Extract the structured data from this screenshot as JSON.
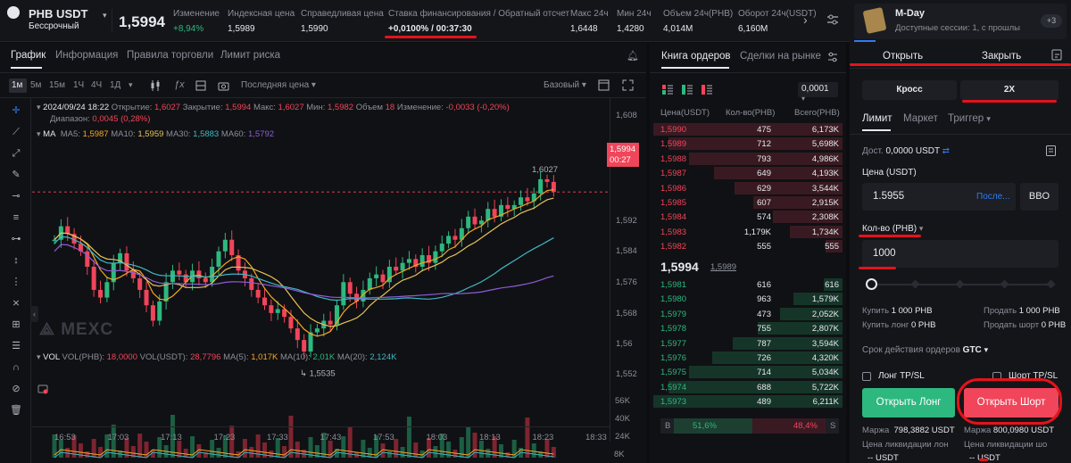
{
  "header": {
    "symbol": "PHB USDT",
    "contract_type": "Бессрочный",
    "last_price": "1,5994",
    "stats": [
      {
        "label": "Изменение",
        "value": "+8,94%"
      },
      {
        "label": "Индексная цена",
        "value": "1,5989"
      },
      {
        "label": "Справедливая цена",
        "value": "1,5990"
      },
      {
        "label": "Ставка финансирования / Обратный отсчет",
        "value": "+0,0100% / 00:37:30"
      },
      {
        "label": "Макс 24ч",
        "value": "1,6448"
      },
      {
        "label": "Мин 24ч",
        "value": "1,4280"
      },
      {
        "label": "Объем 24ч(PHB)",
        "value": "4,014M"
      },
      {
        "label": "Оборот 24ч(USDT)",
        "value": "6,160M"
      }
    ]
  },
  "chart_tabs": [
    "График",
    "Информация",
    "Правила торговли",
    "Лимит риска"
  ],
  "intervals": [
    "1м",
    "5м",
    "15м",
    "1Ч",
    "4Ч",
    "1Д"
  ],
  "price_type": "Последняя цена",
  "view_mode": "Базовый",
  "ohlc": {
    "date": "2024/09/24 18:22",
    "open_label": "Открытие:",
    "open": "1,6027",
    "close_label": "Закрытие:",
    "close": "1,5994",
    "high_label": "Макс:",
    "high": "1,6027",
    "low_label": "Мин:",
    "low": "1,5982",
    "vol_label": "Объем",
    "vol": "18",
    "chg_label": "Изменение:",
    "chg": "-0,0033 (-0,20%)",
    "range_label": "Диапазон:",
    "range": "0,0045 (0,28%)"
  },
  "ma": {
    "label": "MA",
    "items": [
      {
        "name": "MA5:",
        "value": "1,5987",
        "color": "#f5a623"
      },
      {
        "name": "MA10:",
        "value": "1,5959",
        "color": "#e8c35a"
      },
      {
        "name": "MA30:",
        "value": "1,5883",
        "color": "#3fb7c6"
      },
      {
        "name": "MA60:",
        "value": "1,5792",
        "color": "#8e5cd9"
      }
    ]
  },
  "price_axis": [
    "1,608",
    "1,592",
    "1,584",
    "1,576",
    "1,568",
    "1,56",
    "1,552"
  ],
  "current_price_tag": {
    "price": "1,5994",
    "timer": "00:27"
  },
  "chart_annotations": {
    "high": "1,6027",
    "low": "1,5535"
  },
  "watermark": "MEXC",
  "volume_legend": {
    "vol": "VOL",
    "phb_label": "VOL(PHB):",
    "phb_value": "18,0000",
    "usdt_label": "VOL(USDT):",
    "usdt_value": "28,7796",
    "ma5_label": "MA(5):",
    "ma5_value": "1,017K",
    "ma10_label": "MA(10):",
    "ma10_value": "2,01K",
    "ma20_label": "MA(20):",
    "ma20_value": "2,124K"
  },
  "volume_axis": [
    "56K",
    "40K",
    "24K",
    "8K"
  ],
  "time_axis": [
    "16:53",
    "17:03",
    "17:13",
    "17:23",
    "17:33",
    "17:43",
    "17:53",
    "18:03",
    "18:13",
    "18:23",
    "18:33"
  ],
  "orderbook": {
    "tabs": [
      "Книга ордеров",
      "Сделки на рынке"
    ],
    "tick": "0,0001",
    "cols": [
      "Цена(USDT)",
      "Кол-во(PHB)",
      "Всего(PHB)"
    ],
    "asks": [
      {
        "price": "1,5990",
        "qty": "475",
        "total": "6,173K",
        "depth": 1.0
      },
      {
        "price": "1,5989",
        "qty": "712",
        "total": "5,698K",
        "depth": 0.92
      },
      {
        "price": "1,5988",
        "qty": "793",
        "total": "4,986K",
        "depth": 0.81
      },
      {
        "price": "1,5987",
        "qty": "649",
        "total": "4,193K",
        "depth": 0.68
      },
      {
        "price": "1,5986",
        "qty": "629",
        "total": "3,544K",
        "depth": 0.57
      },
      {
        "price": "1,5985",
        "qty": "607",
        "total": "2,915K",
        "depth": 0.47
      },
      {
        "price": "1,5984",
        "qty": "574",
        "total": "2,308K",
        "depth": 0.37
      },
      {
        "price": "1,5983",
        "qty": "1,179K",
        "total": "1,734K",
        "depth": 0.28
      },
      {
        "price": "1,5982",
        "qty": "555",
        "total": "555",
        "depth": 0.09
      }
    ],
    "mid_price": "1,5994",
    "mid_index": "1,5989",
    "bids": [
      {
        "price": "1,5981",
        "qty": "616",
        "total": "616",
        "depth": 0.1
      },
      {
        "price": "1,5980",
        "qty": "963",
        "total": "1,579K",
        "depth": 0.26
      },
      {
        "price": "1,5979",
        "qty": "473",
        "total": "2,052K",
        "depth": 0.33
      },
      {
        "price": "1,5978",
        "qty": "755",
        "total": "2,807K",
        "depth": 0.45
      },
      {
        "price": "1,5977",
        "qty": "787",
        "total": "3,594K",
        "depth": 0.58
      },
      {
        "price": "1,5976",
        "qty": "726",
        "total": "4,320K",
        "depth": 0.69
      },
      {
        "price": "1,5975",
        "qty": "714",
        "total": "5,034K",
        "depth": 0.81
      },
      {
        "price": "1,5974",
        "qty": "688",
        "total": "5,722K",
        "depth": 0.92
      },
      {
        "price": "1,5973",
        "qty": "489",
        "total": "6,211K",
        "depth": 1.0
      }
    ],
    "ratio_buy_label": "B",
    "ratio_buy": "51,6%",
    "ratio_sell": "48,4%",
    "ratio_sell_label": "S",
    "ratio_buy_fraction": 0.516
  },
  "promo": {
    "title": "M-Day",
    "subtitle": "Доступные сессии: 1, с прошлы",
    "badge": "+3"
  },
  "order": {
    "open_tab": "Открыть",
    "close_tab": "Закрыть",
    "margin_mode": "Кросс",
    "leverage": "2X",
    "types": [
      "Лимит",
      "Маркет",
      "Триггер"
    ],
    "available_label": "Дост.",
    "available_value": "0,0000 USDT",
    "price_label": "Цена (USDT)",
    "price_value": "1.5955",
    "last_link": "После...",
    "bbo": "BBO",
    "qty_label": "Кол-во (PHB)",
    "qty_value": "1000",
    "slider_value": 0,
    "buy_label": "Купить",
    "buy_value": "1 000 PHB",
    "sell_label": "Продать",
    "sell_value": "1 000 PHB",
    "buy_long_label": "Купить лонг",
    "buy_long_value": "0 PHB",
    "sell_short_label": "Продать шорт",
    "sell_short_value": "0 PHB",
    "tif_label": "Срок действия ордеров",
    "tif_value": "GTC",
    "long_tpsl": "Лонг TP/SL",
    "short_tpsl": "Шорт TP/SL",
    "open_long": "Открыть Лонг",
    "open_short": "Открыть Шорт",
    "margin_label": "Маржа",
    "margin_long": "798,3882 USDT",
    "margin_short": "800,0980 USDT",
    "liq_label": "Цена ликвидации лон",
    "liq_label_short": "Цена ликвидации шо",
    "liq_long": "-- USDT",
    "liq_short": "-- USDT"
  },
  "colors": {
    "green": "#2db87f",
    "red": "#f0455a",
    "annotation": "#e3131b",
    "accent": "#2f7bf5"
  }
}
